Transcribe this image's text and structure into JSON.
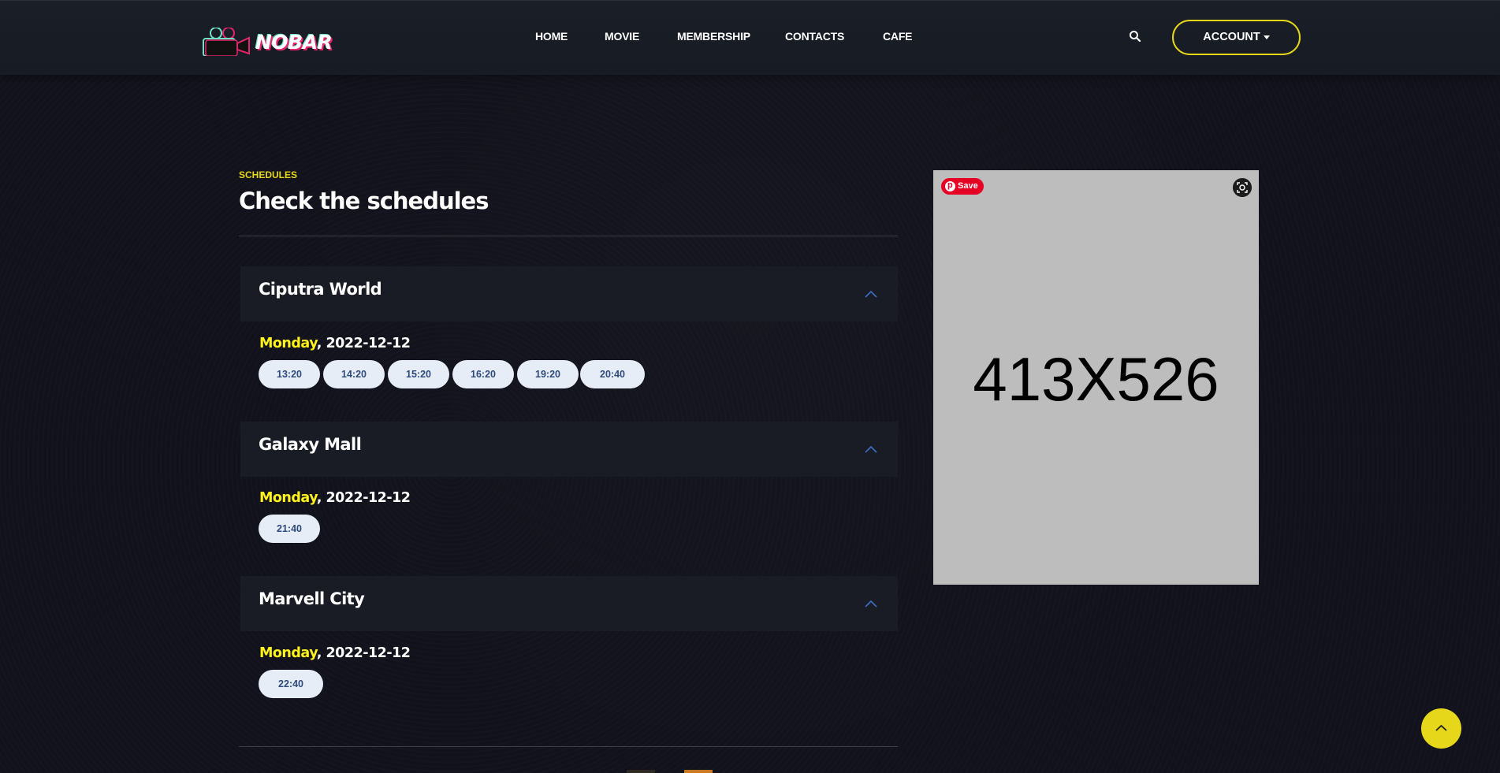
{
  "header": {
    "logo_text": "NOBAR",
    "nav": [
      "HOME",
      "MOVIE",
      "MEMBERSHIP",
      "CONTACTS",
      "CAFE"
    ],
    "account_label": "ACCOUNT"
  },
  "section": {
    "eyebrow": "SCHEDULES",
    "title": "Check the schedules"
  },
  "cinemas": [
    {
      "name": "Ciputra World",
      "day": "Monday",
      "date": ", 2022-12-12",
      "times": [
        "13:20",
        "14:20",
        "15:20",
        "16:20",
        "19:20",
        "20:40"
      ]
    },
    {
      "name": "Galaxy Mall",
      "day": "Monday",
      "date": ", 2022-12-12",
      "times": [
        "21:40"
      ]
    },
    {
      "name": "Marvell City",
      "day": "Monday",
      "date": ", 2022-12-12",
      "times": [
        "22:40"
      ]
    }
  ],
  "ad": {
    "label": "413X526",
    "save_label": "Save"
  },
  "colors": {
    "accent": "#e7d71a",
    "day_highlight": "#fff21a",
    "pill_bg": "#e6edf7",
    "pill_text": "#2d4a7a",
    "pinterest": "#e60023"
  },
  "icons": [
    "search-icon",
    "chevron-up-icon",
    "lens-icon",
    "pinterest-icon",
    "arrow-up-icon",
    "camera-icon"
  ]
}
